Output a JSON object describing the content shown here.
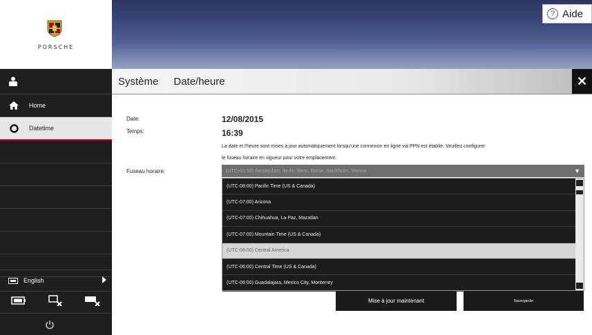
{
  "brand": {
    "wordmark": "PORSCHE"
  },
  "header": {
    "help_label": "Aide"
  },
  "title": {
    "section": "Système",
    "page": "Date/heure"
  },
  "sidebar": {
    "nav": [
      {
        "label": "Home",
        "icon": "home-icon"
      },
      {
        "label": "Datetime",
        "icon": "clock-icon",
        "active": true
      }
    ],
    "language": "English",
    "footer_small_text": ""
  },
  "form": {
    "date_label": "Date:",
    "date_value": "12/08/2015",
    "time_label": "Temps:",
    "time_value": "16:39",
    "info_line1": "La date et l'heure sont mises à jour automatiquement lorsqu'une connexion en ligne via PPN est établie. Veuillez configurer",
    "info_line2": "le fuseau horaire en vigueur pour votre emplacement.",
    "timezone_label": "Fuseau horaire:",
    "timezone_selected": "(UTC+01:00) Amsterdam, Berlin, Bern, Rome, Stockholm, Vienna",
    "timezone_options": [
      "(UTC-08:00) Pacific Time (US & Canada)",
      "(UTC-07:00) Arizona",
      "(UTC-07:00) Chihuahua, La Paz, Mazatlan",
      "(UTC-07:00) Mountain Time (US & Canada)",
      "(UTC-06:00) Central America",
      "(UTC-06:00) Central Time (US & Canada)",
      "(UTC-06:00) Guadalajara, Mexico City, Monterrey"
    ],
    "highlighted_option_index": 4
  },
  "buttons": {
    "update": "Mise à jour maintenant",
    "save": "Sauvegarder"
  },
  "colors": {
    "accent": "#c5001f",
    "sidebar_bg": "#1f1f1f",
    "banner": "#3e4a7d"
  }
}
